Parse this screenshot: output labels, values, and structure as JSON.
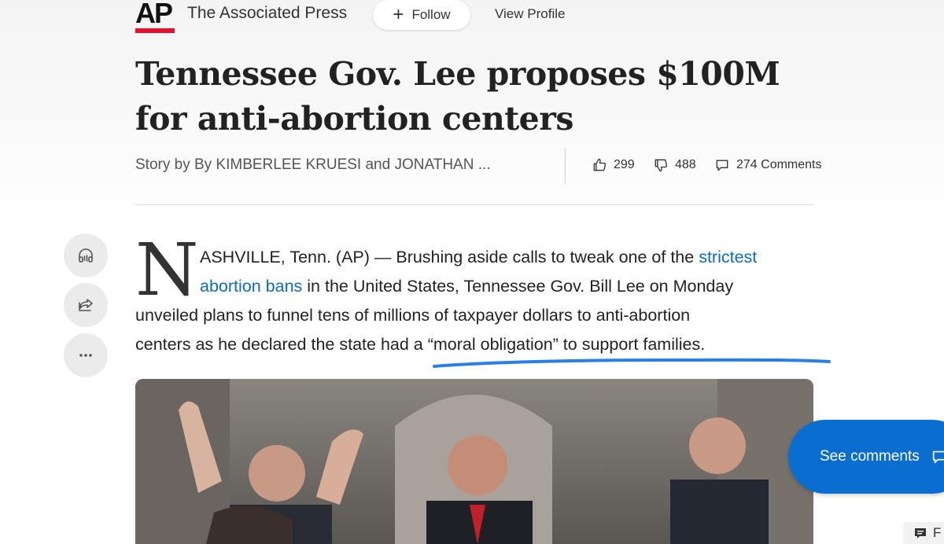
{
  "header": {
    "logo_text": "AP",
    "publisher": "The Associated Press",
    "follow_label": "Follow",
    "view_profile_label": "View Profile"
  },
  "article": {
    "headline": "Tennessee Gov. Lee proposes $100M for anti-abortion centers",
    "byline": "Story by By KIMBERLEE KRUESI and JONATHAN ...",
    "likes": "299",
    "dislikes": "488",
    "comments": "274 Comments",
    "dropcap": "N",
    "body": {
      "line1_text": "ASHVILLE, Tenn. (AP) — Brushing aside calls to tweak one of the ",
      "line1_link": "strictest",
      "line2_link": "abortion bans",
      "line2_text": " in the United States, Tennessee Gov. Bill Lee on Monday",
      "line3": "unveiled plans to funnel tens of millions of taxpayer dollars to anti-abortion",
      "line4": "centers as he declared the state had a “moral obligation” to support families."
    }
  },
  "side_actions": [
    "headphones-icon",
    "share-icon",
    "more-icon"
  ],
  "floating": {
    "see_comments_label": "See comments",
    "corner_label": "F"
  },
  "colors": {
    "link": "#0f6cbd",
    "accent_blue": "#0a6ed1",
    "ap_red": "#e3122b",
    "hand_underline": "#2a7ee8"
  }
}
